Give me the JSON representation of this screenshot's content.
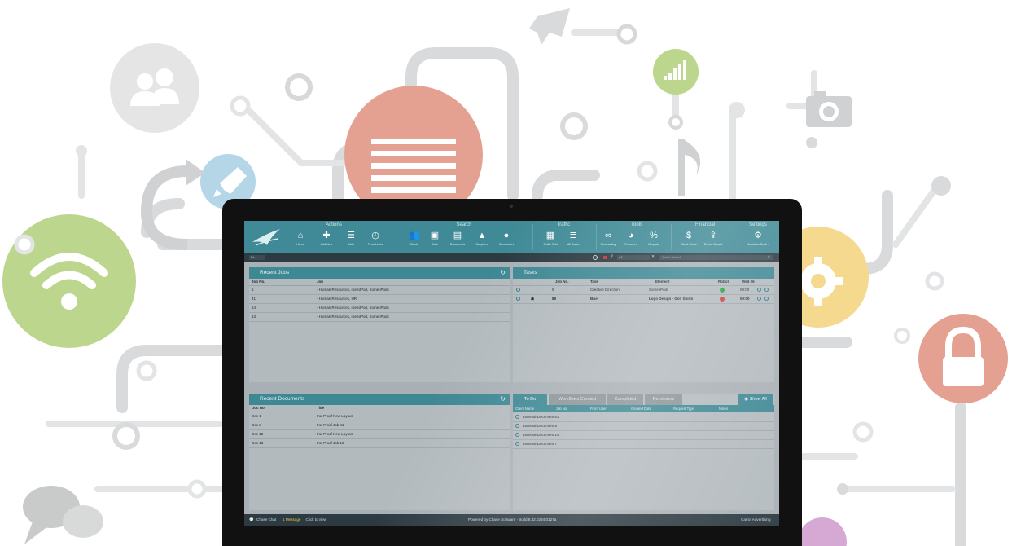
{
  "colors": {
    "teal": "#3f8a96",
    "panel": "#b3babe",
    "dark_bar": "#2c3a41",
    "green_status": "#2fa04a",
    "red_status": "#d23a3a"
  },
  "background_icons": [
    "person-icon",
    "document-icon",
    "rocket-icon",
    "wifi-icon",
    "signal-icon",
    "camera-icon",
    "music-note-icon",
    "gear-icon",
    "lock-icon",
    "chat-icon",
    "redo-arrow-icon"
  ],
  "toolbar": {
    "groups": [
      {
        "title": "Actions",
        "tools": [
          {
            "label": "Home",
            "icon": "home-icon"
          },
          {
            "label": "Add New",
            "icon": "add-new-icon"
          },
          {
            "label": "Table",
            "icon": "table-icon"
          },
          {
            "label": "Timesheets",
            "icon": "timesheets-icon"
          }
        ]
      },
      {
        "title": "Search",
        "tools": [
          {
            "label": "Clients",
            "icon": "clients-icon"
          },
          {
            "label": "Jobs",
            "icon": "jobs-icon"
          },
          {
            "label": "Documents",
            "icon": "documents-icon"
          },
          {
            "label": "Suppliers",
            "icon": "suppliers-icon"
          },
          {
            "label": "Contractors",
            "icon": "contractors-icon"
          }
        ]
      },
      {
        "title": "Traffic",
        "tools": [
          {
            "label": "Traffic Grid",
            "icon": "traffic-grid-icon"
          },
          {
            "label": "All Tasks",
            "icon": "all-tasks-icon"
          }
        ]
      },
      {
        "title": "Tools",
        "tools": [
          {
            "label": "Forecasting",
            "icon": "forecasting-icon"
          },
          {
            "label": "Reports ▾",
            "icon": "reports-icon"
          },
          {
            "label": "Mixpads",
            "icon": "mixpads-icon"
          }
        ]
      },
      {
        "title": "Financial",
        "tools": [
          {
            "label": "Stock Costs",
            "icon": "stock-costs-icon"
          },
          {
            "label": "Export Wizard",
            "icon": "export-wizard-icon"
          }
        ]
      },
      {
        "title": "Settings",
        "tools": [
          {
            "label": "Jonathan Cook ▾",
            "icon": "settings-gear-icon"
          }
        ]
      }
    ]
  },
  "subbar": {
    "filter_value": "Ex",
    "filter_value_2": "All",
    "hash": "#",
    "search_placeholder": "Quick Search"
  },
  "recent_jobs": {
    "title": "Recent Jobs",
    "columns": [
      "Job No.",
      "Job"
    ],
    "rows": [
      [
        "1",
        "- Human Resources, iSeedPod, Some iPods"
      ],
      [
        "41",
        "- Human Resources, HR"
      ],
      [
        "14",
        "- Human Resources, iSeedPod, Some iPods"
      ],
      [
        "13",
        "- Human Resources, iSeedPod, Some iPods"
      ]
    ]
  },
  "tasks": {
    "title": "Tasks",
    "columns": [
      "Job No.",
      "Task",
      "Element",
      "Robot",
      "Wed 26"
    ],
    "rows": [
      {
        "job": "5",
        "task": "Creative Direction",
        "element": "Some iPods",
        "status": "green",
        "time": "00:00"
      },
      {
        "job": "88",
        "task": "Brief",
        "element": "Logo Design - Golf Shirts",
        "status": "red",
        "time": "00:00"
      }
    ]
  },
  "recent_documents": {
    "title": "Recent Documents",
    "columns": [
      "Doc No.",
      "Title"
    ],
    "rows": [
      [
        "Doc 1",
        "For Proof New Layout"
      ],
      [
        "Doc 8",
        "For Proof Job 41"
      ],
      [
        "Doc 12",
        "For Proof New Layout"
      ],
      [
        "Doc 13",
        "For Proof Job 13"
      ]
    ]
  },
  "todo": {
    "tabs": [
      "To Do",
      "Workflows Created",
      "Completed",
      "Reminders"
    ],
    "show_all": "Show All",
    "columns": [
      "Client Name",
      "Job No.",
      "From User",
      "Created Date",
      "Request Type",
      "Notes"
    ],
    "rows": [
      "External Document 61",
      "External Document 8",
      "External Document 14",
      "External Document 7"
    ]
  },
  "footer": {
    "chat": "Chase Chat",
    "message": "1 Message",
    "click": "| Click to view",
    "powered": "Powered by Chase Software - Build 8.32.0284.0127a",
    "company": "Carrot Advertising"
  }
}
